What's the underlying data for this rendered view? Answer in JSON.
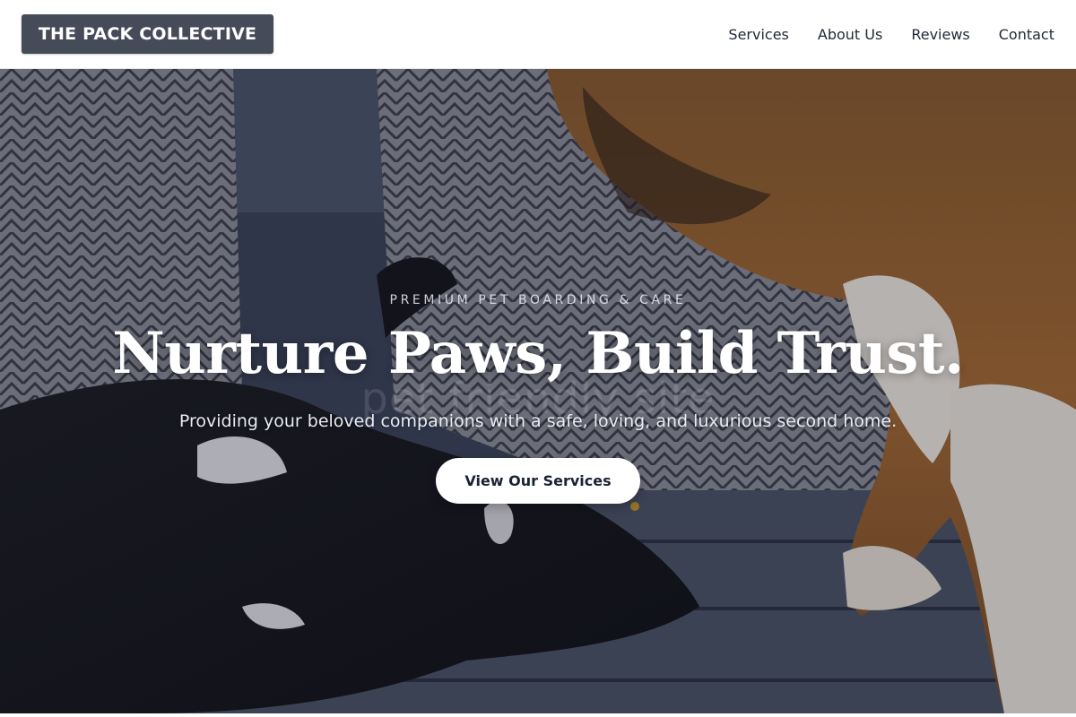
{
  "header": {
    "logo": "THE PACK COLLECTIVE",
    "nav": [
      "Services",
      "About Us",
      "Reviews",
      "Contact"
    ]
  },
  "hero": {
    "eyebrow": "PREMIUM PET BOARDING & CARE",
    "headline": "Nurture Paws, Build Trust.",
    "subtitle": "Providing your beloved companions with a safe, loving, and luxurious second home.",
    "cta": "View Our Services",
    "watermark": "pet friendly site"
  },
  "colors": {
    "logo_bg": "#454b59",
    "hero_overlay": "#1e2638",
    "cta_bg": "#ffffff",
    "cta_text": "#1a2233"
  }
}
